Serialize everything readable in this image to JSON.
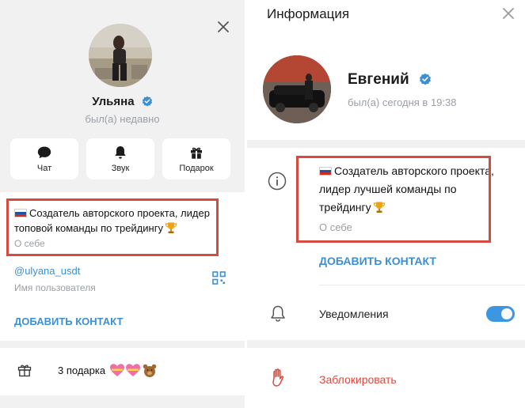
{
  "left_panel": {
    "name": "Ульяна",
    "status": "был(а) недавно",
    "actions": [
      {
        "label": "Чат",
        "icon": "chat-icon"
      },
      {
        "label": "Звук",
        "icon": "bell-icon"
      },
      {
        "label": "Подарок",
        "icon": "gift-icon"
      }
    ],
    "bio": "Создатель авторского проекта, лидер топовой команды по трейдингу",
    "bio_label": "О себе",
    "username": "@ulyana_usdt",
    "username_label": "Имя пользователя",
    "add_contact": "ДОБАВИТЬ КОНТАКТ",
    "gifts_text": "3 подарка"
  },
  "right_panel": {
    "title": "Информация",
    "name": "Евгений",
    "status": "был(а) сегодня в 19:38",
    "bio": "Создатель авторского проекта, лидер лучшей команды по трейдингу",
    "bio_label": "О себе",
    "add_contact": "ДОБАВИТЬ КОНТАКТ",
    "notifications_label": "Уведомления",
    "notifications_on": true,
    "block_label": "Заблокировать"
  },
  "colors": {
    "accent": "#3d8fd4",
    "toggle": "#3d96e0",
    "danger": "#e0483b",
    "highlight": "#d64b3f",
    "muted": "#9aa0a6"
  }
}
